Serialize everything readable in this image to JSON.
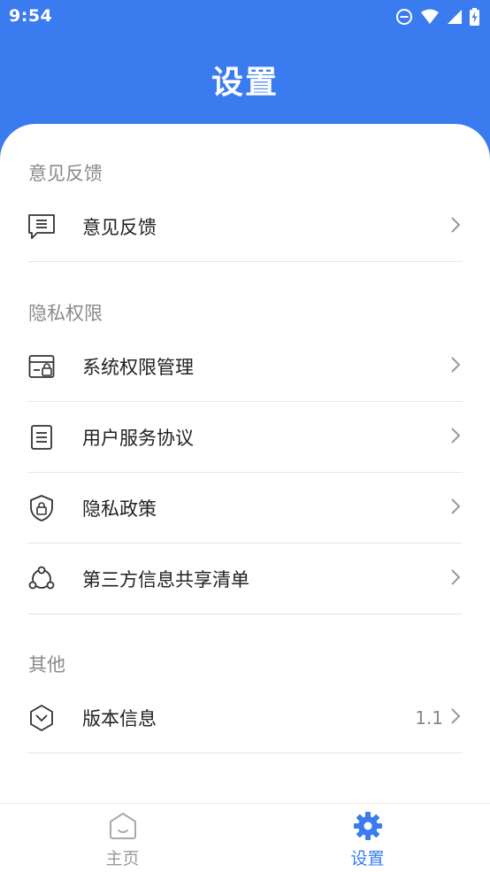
{
  "status_bar": {
    "time": "9:54",
    "icons": [
      "do-not-disturb-icon",
      "wifi-icon",
      "signal-icon",
      "battery-charging-icon"
    ]
  },
  "header": {
    "title": "设置"
  },
  "sections": [
    {
      "title": "意见反馈",
      "items": [
        {
          "label": "意见反馈",
          "icon": "feedback-message-icon"
        }
      ]
    },
    {
      "title": "隐私权限",
      "items": [
        {
          "label": "系统权限管理",
          "icon": "permission-card-icon"
        },
        {
          "label": "用户服务协议",
          "icon": "document-icon"
        },
        {
          "label": "隐私政策",
          "icon": "shield-lock-icon"
        },
        {
          "label": "第三方信息共享清单",
          "icon": "share-nodes-icon"
        }
      ]
    },
    {
      "title": "其他",
      "items": [
        {
          "label": "版本信息",
          "icon": "version-hexagon-icon",
          "value": "1.1"
        }
      ]
    }
  ],
  "tabbar": {
    "tabs": [
      {
        "label": "主页",
        "icon": "home-icon",
        "active": false
      },
      {
        "label": "设置",
        "icon": "gear-icon",
        "active": true
      }
    ],
    "active_color": "#3a7cf0",
    "inactive_color": "#9a9a9a"
  },
  "colors": {
    "primary": "#3a7cf0"
  }
}
